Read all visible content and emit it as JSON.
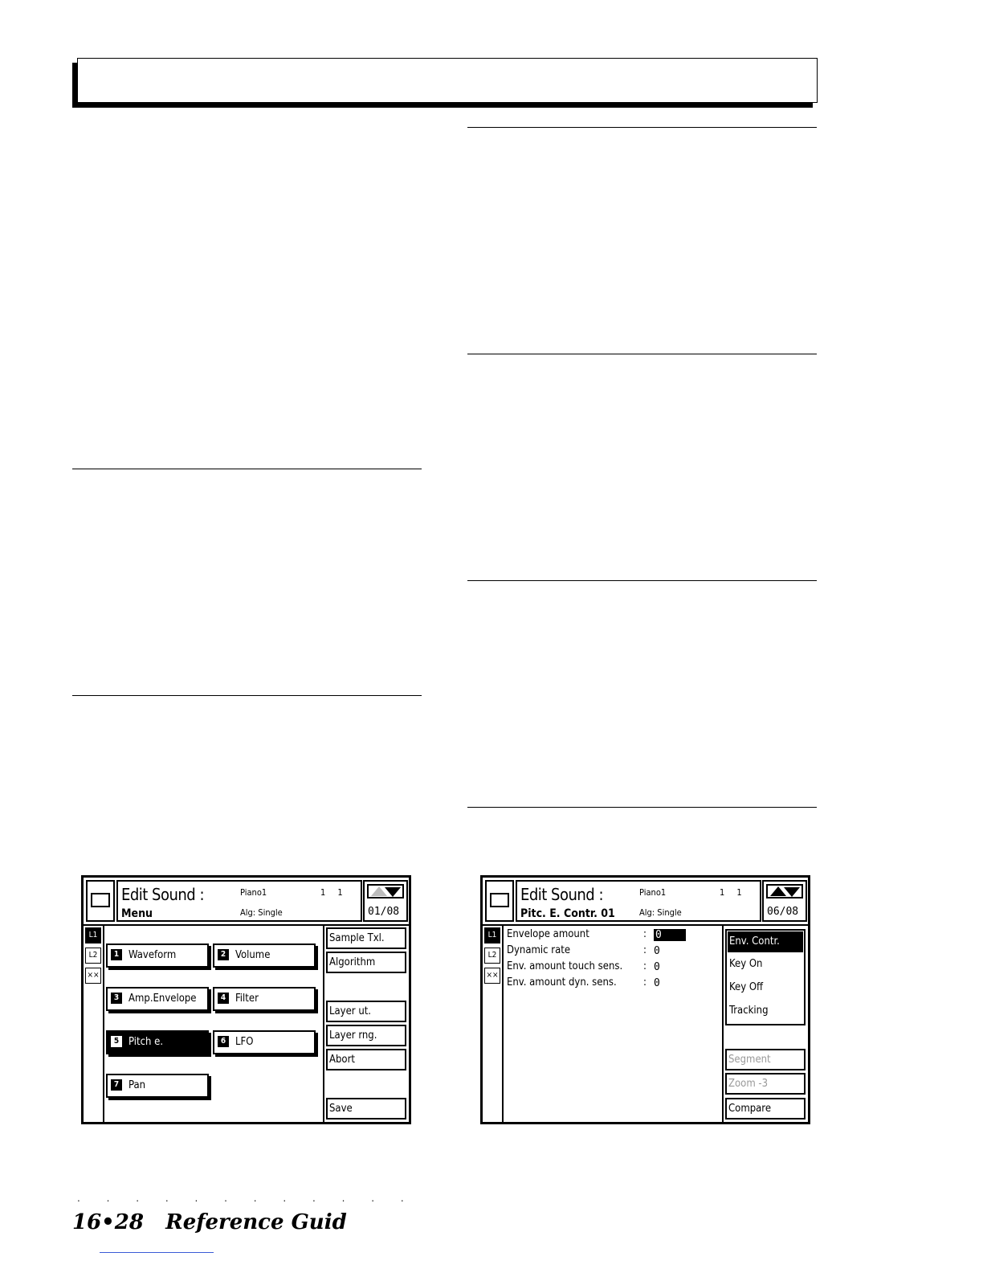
{
  "footer": {
    "dots": ". . . . . . . . . . . . . . . . . . . . . . .",
    "page_ref": "16•28",
    "title": "Reference Guid"
  },
  "screen1": {
    "title": "Edit Sound :",
    "subtitle": "Menu",
    "sound": "Piano1",
    "nums": "1 1",
    "alg": "Alg: Single",
    "page": "01/08",
    "layers": [
      "L1",
      "L2",
      "××"
    ],
    "menu": [
      {
        "num": "1",
        "label": "Waveform"
      },
      {
        "num": "2",
        "label": "Volume"
      },
      {
        "num": "3",
        "label": "Amp.Envelope"
      },
      {
        "num": "4",
        "label": "Filter"
      },
      {
        "num": "5",
        "label": "Pitch e."
      },
      {
        "num": "6",
        "label": "LFO"
      },
      {
        "num": "7",
        "label": "Pan"
      }
    ],
    "side": [
      "Sample Txl.",
      "Algorithm",
      "Layer ut.",
      "Layer rng.",
      "Abort",
      "Save"
    ]
  },
  "screen2": {
    "title": "Edit Sound :",
    "subtitle": "Pitc. E. Contr. 01",
    "sound": "Piano1",
    "nums": "1 1",
    "alg": "Alg: Single",
    "page": "06/08",
    "layers": [
      "L1",
      "L2",
      "××"
    ],
    "params": [
      {
        "label": "Envelope amount",
        "colon": ":",
        "value": "0"
      },
      {
        "label": "Dynamic rate",
        "colon": ":",
        "value": "0"
      },
      {
        "label": "Env. amount touch sens.",
        "colon": ":",
        "value": "0"
      },
      {
        "label": "Env. amount dyn. sens.",
        "colon": ":",
        "value": "0"
      }
    ],
    "menu": [
      "Env. Contr.",
      "Key On",
      "Key Off",
      "Tracking"
    ],
    "side": [
      "Segment",
      "Zoom -3",
      "Compare"
    ]
  }
}
